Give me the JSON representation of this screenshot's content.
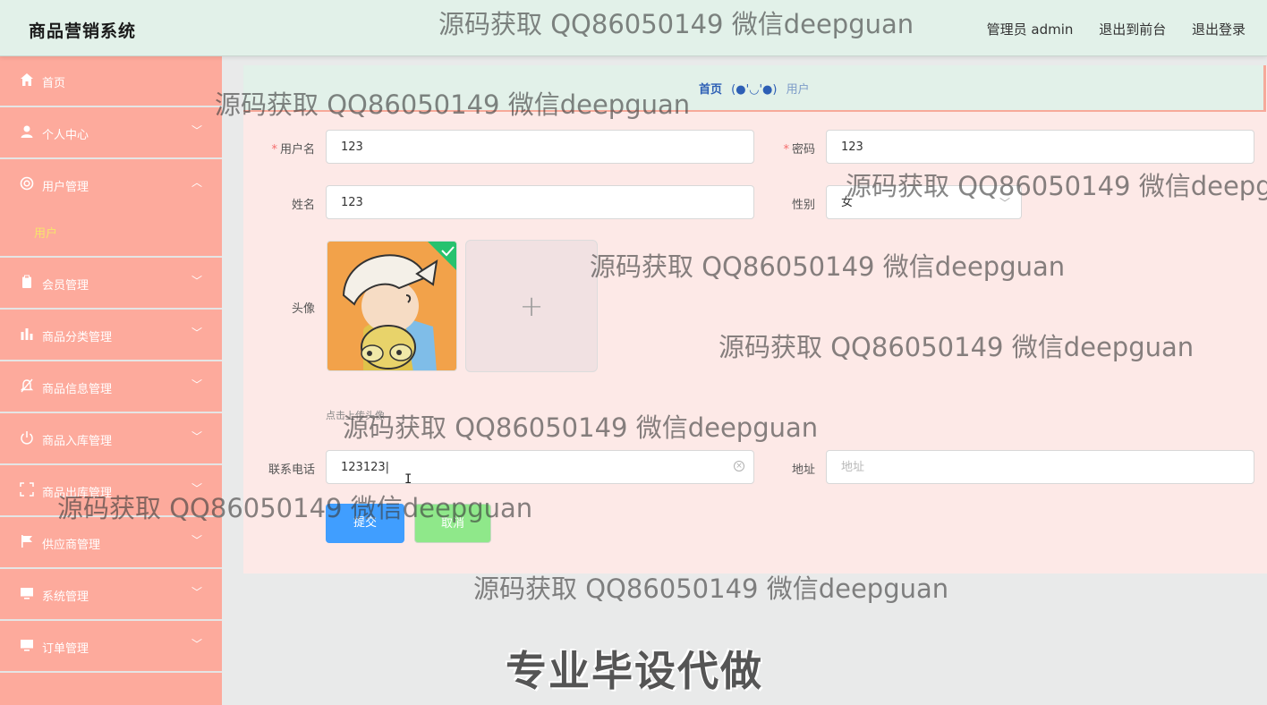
{
  "header": {
    "brand": "商品营销系统",
    "user": "管理员 admin",
    "to_front": "退出到前台",
    "logout": "退出登录"
  },
  "sidebar": {
    "items": [
      {
        "label": "首页",
        "icon": "home-icon"
      },
      {
        "label": "个人中心",
        "icon": "user-icon"
      },
      {
        "label": "用户管理",
        "icon": "users-icon",
        "expanded": true
      },
      {
        "label": "会员管理",
        "icon": "clipboard-icon"
      },
      {
        "label": "商品分类管理",
        "icon": "chart-icon"
      },
      {
        "label": "商品信息管理",
        "icon": "bell-off-icon"
      },
      {
        "label": "商品入库管理",
        "icon": "power-icon"
      },
      {
        "label": "商品出库管理",
        "icon": "scan-icon"
      },
      {
        "label": "供应商管理",
        "icon": "flag-icon"
      },
      {
        "label": "系统管理",
        "icon": "monitor-icon"
      },
      {
        "label": "订单管理",
        "icon": "monitor-icon"
      }
    ],
    "submenu_user": "用户"
  },
  "breadcrumb": {
    "home": "首页",
    "emoticon": "(●'◡'●)",
    "current": "用户"
  },
  "form": {
    "username_label": "用户名",
    "username_value": "123",
    "password_label": "密码",
    "password_value": "123",
    "name_label": "姓名",
    "name_value": "123",
    "gender_label": "性别",
    "gender_value": "女",
    "avatar_label": "头像",
    "avatar_hint": "点击上传头像",
    "phone_label": "联系电话",
    "phone_value": "123123",
    "address_label": "地址",
    "address_placeholder": "地址",
    "submit": "提交",
    "cancel": "取消"
  },
  "watermarks": {
    "text": "源码获取 QQ86050149 微信deepguan",
    "big": "专业毕设代做"
  },
  "colors": {
    "sidebar_bg": "#fdaa9c",
    "header_bg": "#e2f1e9",
    "content_bg": "#fde9e7",
    "submit_blue": "#409eff",
    "cancel_green": "#8fe88a",
    "submenu_active": "#f6e36c"
  }
}
